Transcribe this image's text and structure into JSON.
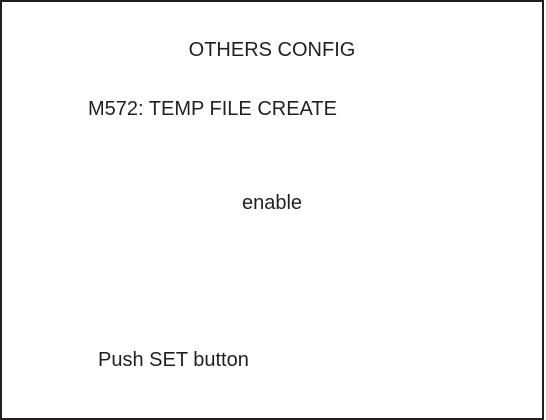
{
  "screen": {
    "title": "OTHERS CONFIG",
    "setting": "M572:  TEMP FILE CREATE",
    "value": "enable",
    "prompt": "Push SET button"
  }
}
